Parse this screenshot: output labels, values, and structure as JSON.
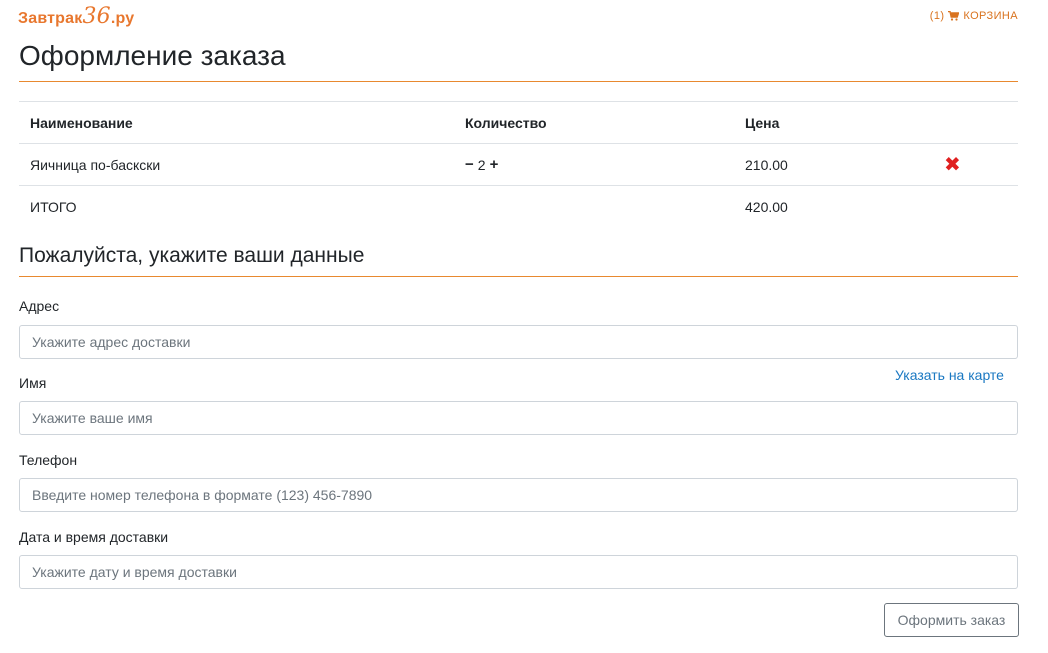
{
  "header": {
    "logo_prefix": "Завтрак",
    "logo_number": "36",
    "logo_suffix": ".ру",
    "cart_count": "(1)",
    "cart_label": "КОРЗИНА",
    "cart_icon": "cart-icon"
  },
  "page_title": "Оформление заказа",
  "table": {
    "headers": [
      "Наименование",
      "Количество",
      "Цена"
    ],
    "items": [
      {
        "name": "Яичница по-баскски",
        "minus": "−",
        "qty": "2",
        "plus": "+",
        "price": "210.00",
        "remove_icon": "close-icon",
        "remove_symbol": "✖"
      }
    ],
    "total_label": "ИТОГО",
    "total_value": "420.00"
  },
  "form": {
    "title": "Пожалуйста, укажите ваши данные",
    "address_label": "Адрес",
    "address_placeholder": "Укажите адрес доставки",
    "map_link": "Указать на карте",
    "name_label": "Имя",
    "name_placeholder": "Укажите ваше имя",
    "phone_label": "Телефон",
    "phone_placeholder": "Введите номер телефона в формате (123) 456-7890",
    "datetime_label": "Дата и время доставки",
    "datetime_placeholder": "Укажите дату и время доставки",
    "submit_label": "Оформить заказ"
  },
  "colors": {
    "accent": "#e8892f",
    "link": "#1a78c2",
    "remove": "#e02020"
  }
}
